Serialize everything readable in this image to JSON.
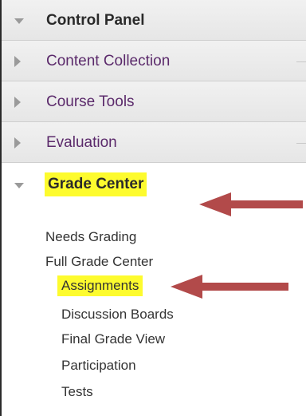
{
  "control_panel": {
    "title": "Control Panel",
    "items": [
      {
        "label": "Content Collection"
      },
      {
        "label": "Course Tools"
      },
      {
        "label": "Evaluation"
      }
    ]
  },
  "grade_center": {
    "title": "Grade Center",
    "links": [
      {
        "label": "Needs Grading"
      },
      {
        "label": "Full Grade Center"
      }
    ],
    "sublinks": [
      {
        "label": "Assignments"
      },
      {
        "label": "Discussion Boards"
      },
      {
        "label": "Final Grade View"
      },
      {
        "label": "Participation"
      },
      {
        "label": "Tests"
      }
    ]
  },
  "colors": {
    "highlight": "#fdfb2e",
    "section_link": "#5b2a6b",
    "arrow": "#9a9a9a",
    "callout_arrow": "#b24a4a"
  },
  "icons": [
    "collapse-arrow-icon",
    "expand-arrow-icon",
    "callout-arrow-icon"
  ]
}
